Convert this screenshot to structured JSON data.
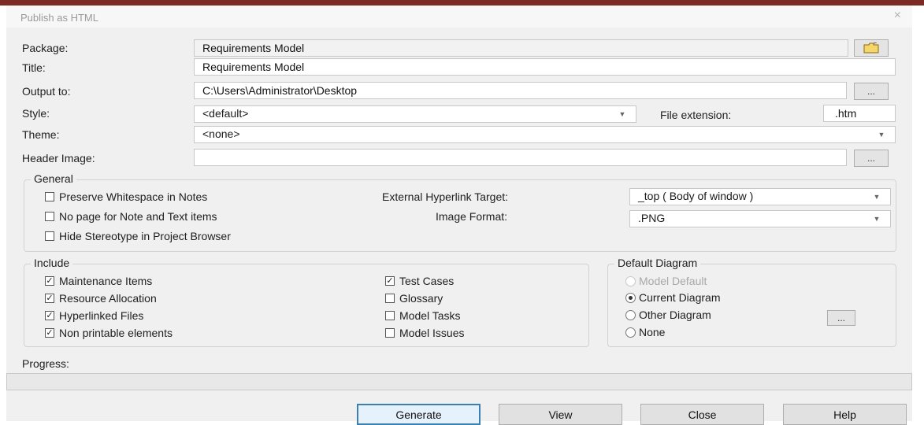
{
  "dialog": {
    "title": "Publish as HTML",
    "close_glyph": "×"
  },
  "labels": {
    "package": "Package:",
    "title": "Title:",
    "output": "Output to:",
    "style": "Style:",
    "file_ext": "File extension:",
    "theme": "Theme:",
    "header_image": "Header Image:",
    "progress": "Progress:"
  },
  "fields": {
    "package": "Requirements Model",
    "title": "Requirements Model",
    "output": "C:\\Users\\Administrator\\Desktop",
    "style": "<default>",
    "file_ext": ".htm",
    "theme": "<none>",
    "header_image": ""
  },
  "browse_label": "...",
  "general": {
    "title": "General",
    "checks": [
      {
        "label": "Preserve Whitespace in Notes",
        "checked": false
      },
      {
        "label": "No page for Note and Text items",
        "checked": false
      },
      {
        "label": "Hide Stereotype in Project Browser",
        "checked": false
      }
    ],
    "ext_target_label": "External Hyperlink Target:",
    "ext_target_value": "_top  ( Body of window )",
    "image_format_label": "Image Format:",
    "image_format_value": ".PNG"
  },
  "include": {
    "title": "Include",
    "col1": [
      {
        "label": "Maintenance Items",
        "checked": true
      },
      {
        "label": "Resource Allocation",
        "checked": true
      },
      {
        "label": "Hyperlinked Files",
        "checked": true
      },
      {
        "label": "Non printable elements",
        "checked": true
      }
    ],
    "col2": [
      {
        "label": "Test Cases",
        "checked": true
      },
      {
        "label": "Glossary",
        "checked": false
      },
      {
        "label": "Model Tasks",
        "checked": false
      },
      {
        "label": "Model Issues",
        "checked": false
      }
    ]
  },
  "default_diagram": {
    "title": "Default Diagram",
    "options": [
      "Model Default",
      "Current Diagram",
      "Other Diagram",
      "None"
    ],
    "selected": "Current Diagram"
  },
  "buttons": {
    "generate": "Generate",
    "view": "View",
    "close": "Close",
    "help": "Help"
  },
  "progress_value": 0
}
